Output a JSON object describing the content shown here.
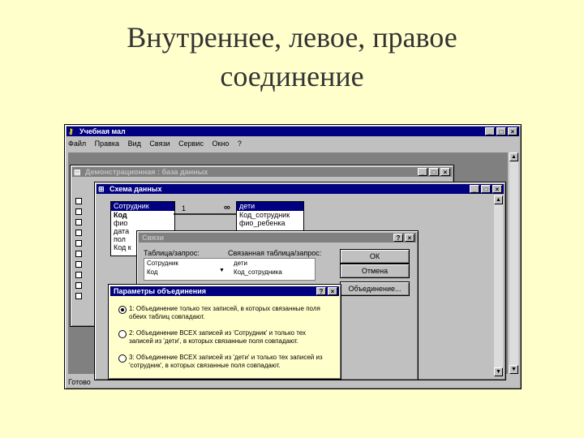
{
  "slide": {
    "title_line1": "Внутреннее, левое, правое",
    "title_line2": "соединение"
  },
  "app": {
    "title": "Учебная мал",
    "menu": [
      "Файл",
      "Правка",
      "Вид",
      "Связи",
      "Сервис",
      "Окно",
      "?"
    ],
    "status": "Готово"
  },
  "db_window": {
    "title": "Демонстрационная : база данных"
  },
  "schema_window": {
    "title": "Схема данных"
  },
  "table_left": {
    "name": "Сотрудник",
    "fields": [
      "Код",
      "фио",
      "дата",
      "пол",
      "Код к"
    ]
  },
  "table_right": {
    "name": "дети",
    "fields": [
      "Код_сотрудник",
      "фио_ребенка"
    ]
  },
  "relation": {
    "one": "1",
    "many": "∞"
  },
  "links_dialog": {
    "title": "Связи",
    "col1_label": "Таблица/запрос:",
    "col2_label": "Связанная таблица/запрос:",
    "col1_value": "Сотрудник",
    "col2_value": "дети",
    "row_left": "Код",
    "row_right": "Код_сотрудника",
    "ok": "ОК",
    "cancel": "Отмена",
    "join": "Объединение..."
  },
  "join_dialog": {
    "title": "Параметры объединения",
    "options": [
      "1: Объединение только тех записей, в которых связанные поля обеих таблиц совпадают.",
      "2: Объединение ВСЕХ записей из 'Сотрудник' и только тех записей из 'дети', в которых связанные поля совпадают.",
      "3: Объединение ВСЕХ записей из 'дети' и только тех записей из 'сотрудник', в которых связанные поля совпадают."
    ],
    "selected": 0
  },
  "icons": {
    "app": "key-icon",
    "minimize": "minimize-icon",
    "maximize": "maximize-icon",
    "close": "close-icon",
    "help": "help-icon",
    "dropdown": "chevron-down-icon"
  }
}
